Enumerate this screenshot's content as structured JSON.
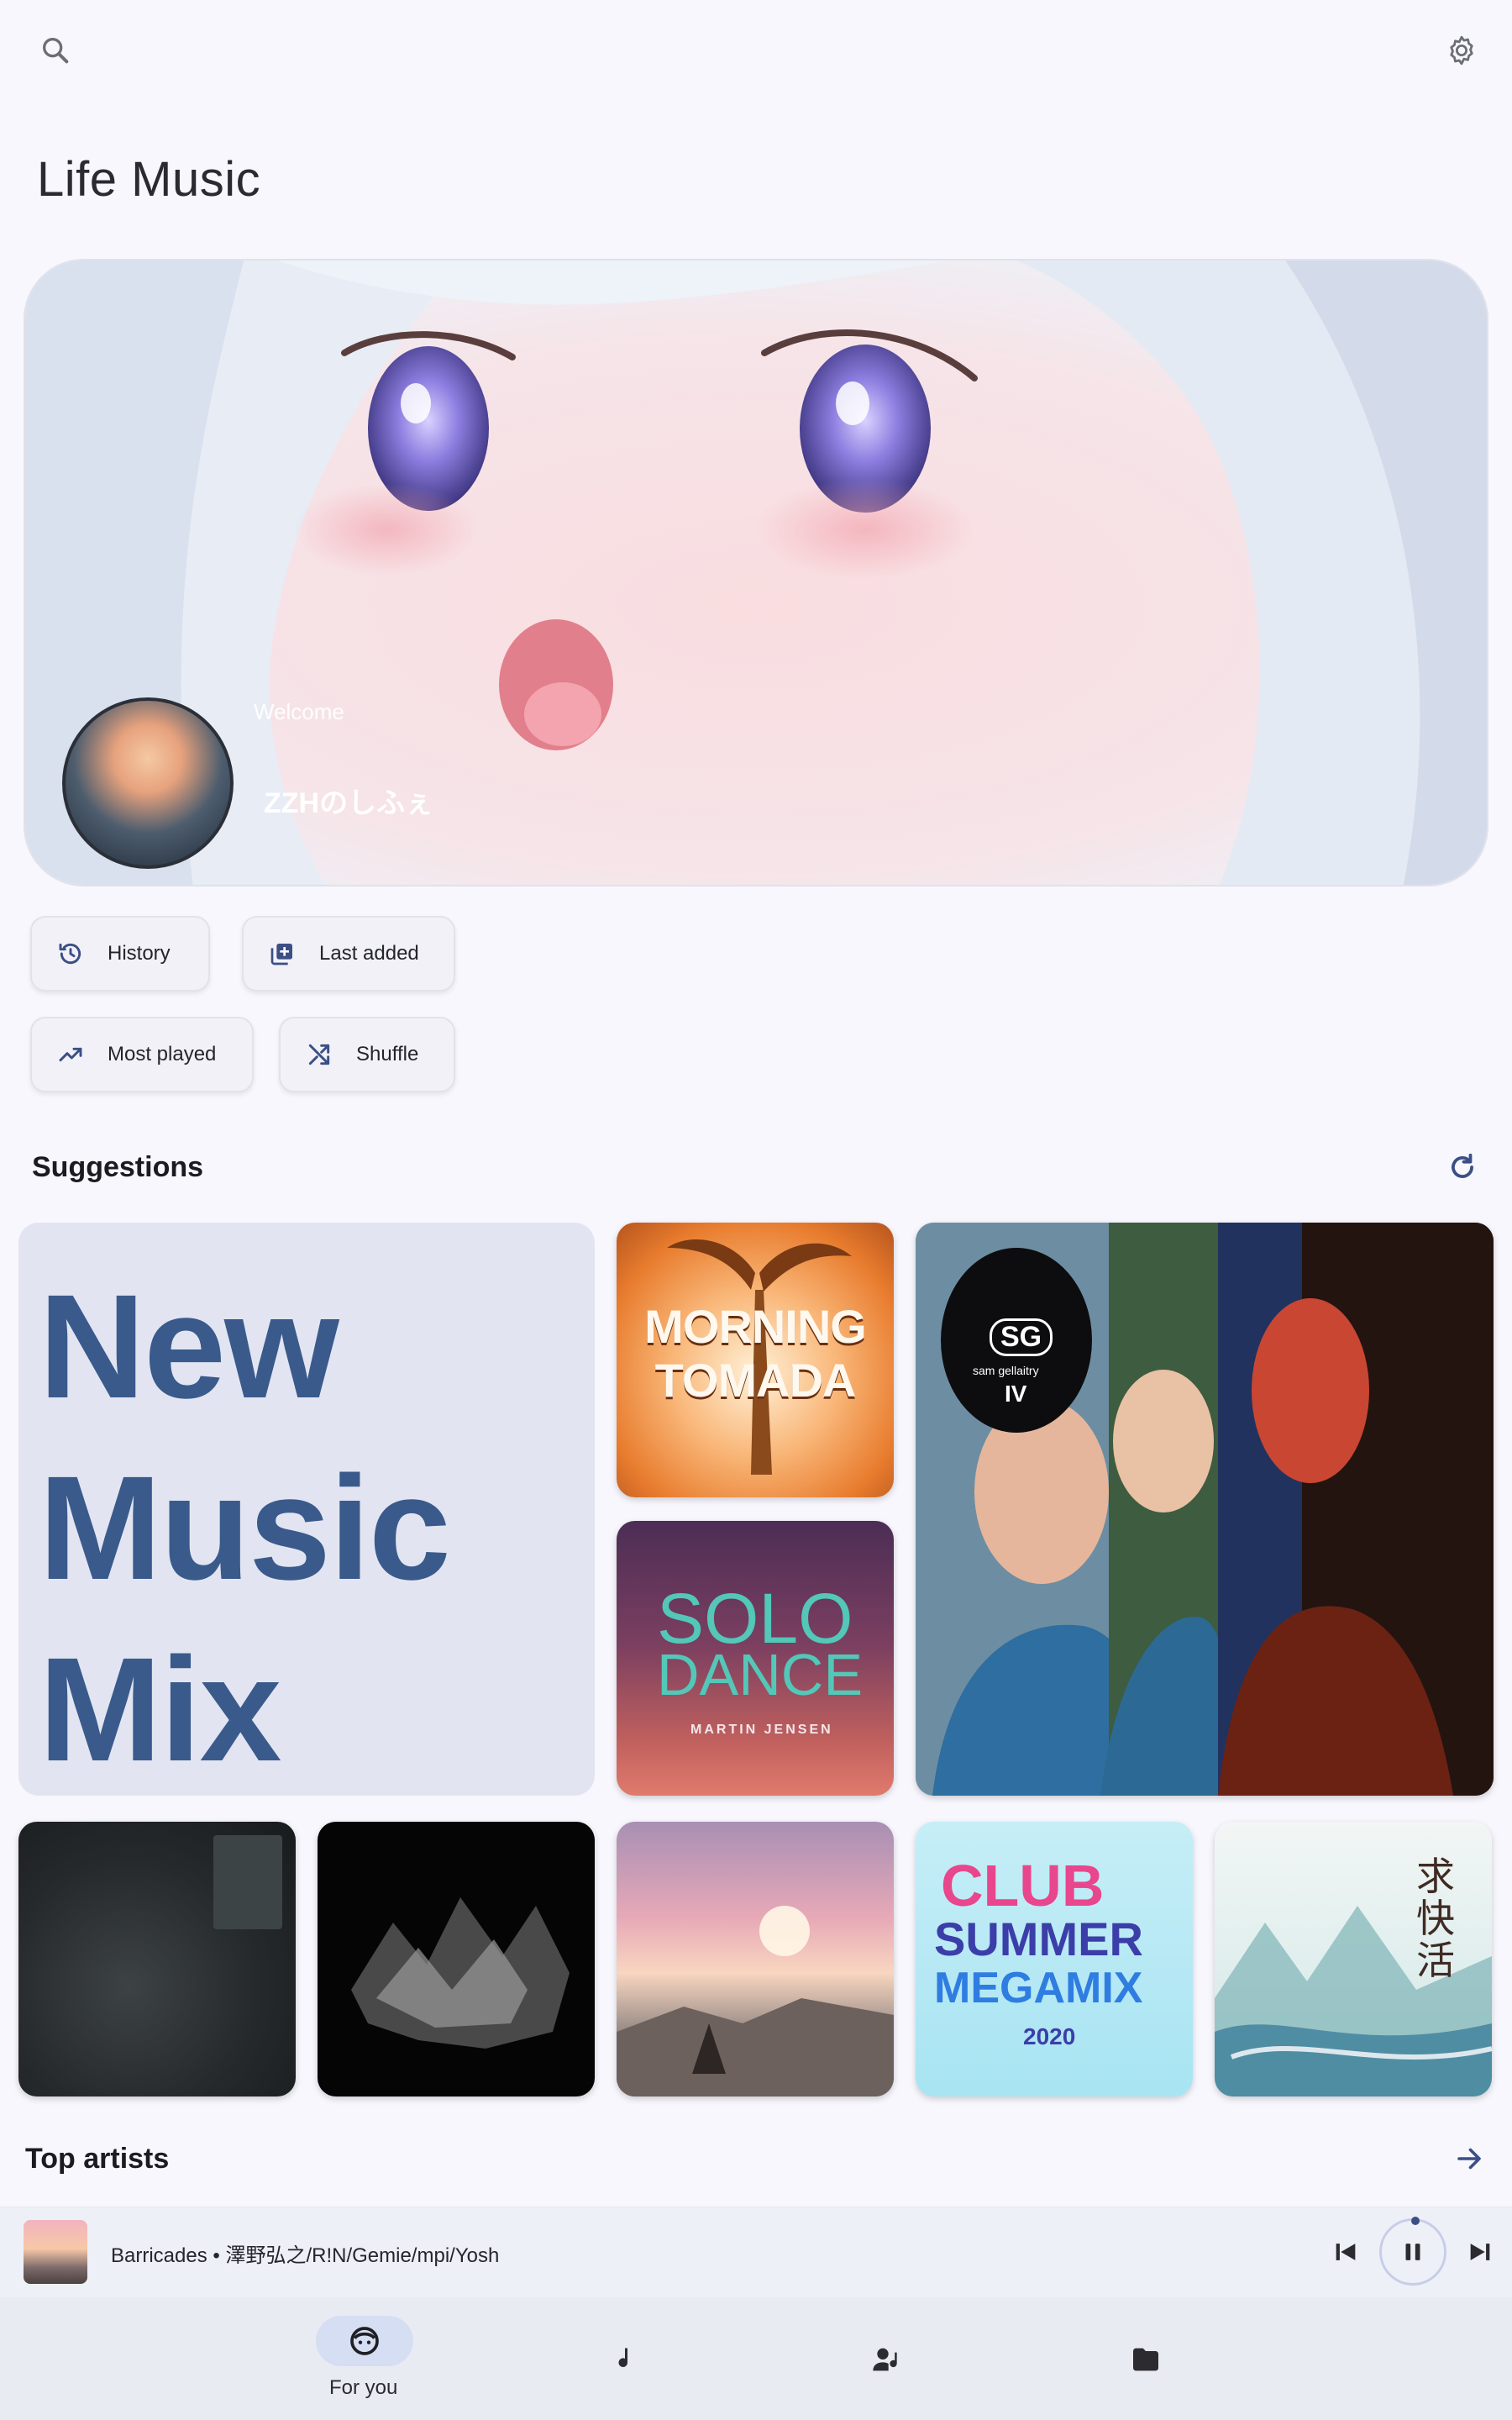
{
  "app": {
    "title": "Life Music"
  },
  "hero": {
    "welcome": "Welcome",
    "username": "ZZHのしふぇ"
  },
  "chips": {
    "history": "History",
    "last_added": "Last added",
    "most_played": "Most played",
    "shuffle": "Shuffle"
  },
  "suggestions": {
    "title": "Suggestions",
    "mix_lines": [
      "New",
      "Music",
      "Mix"
    ],
    "covers": {
      "tomada": "MORNING TOMADA",
      "solo_dance_title_1": "SOLO",
      "solo_dance_title_2": "DANCE",
      "solo_dance_artist": "MARTIN JENSEN",
      "sg_badge": "SG",
      "sg_name": "sam gellaitry",
      "sg_number": "IV",
      "club_line1": "CLUB",
      "club_line2": "SUMMER",
      "club_line3": "MEGAMIX",
      "club_year": "2020",
      "qiu_title": "求快活"
    }
  },
  "top_artists": {
    "title": "Top artists"
  },
  "now_playing": {
    "title": "Barricades • 澤野弘之/R!N/Gemie/mpi/Yosh"
  },
  "nav": {
    "for_you": "For you"
  },
  "icons": [
    "search-icon",
    "settings-icon",
    "history-icon",
    "library-add-icon",
    "trending-up-icon",
    "shuffle-icon",
    "refresh-icon",
    "arrow-forward-icon",
    "skip-previous-icon",
    "pause-icon",
    "skip-next-icon",
    "face-icon",
    "music-note-icon",
    "artist-icon",
    "folder-icon"
  ],
  "colors": {
    "accent": "#3a5a8c",
    "mix_card_bg": "#e2e5f1",
    "nav_pill": "#d6def3"
  }
}
